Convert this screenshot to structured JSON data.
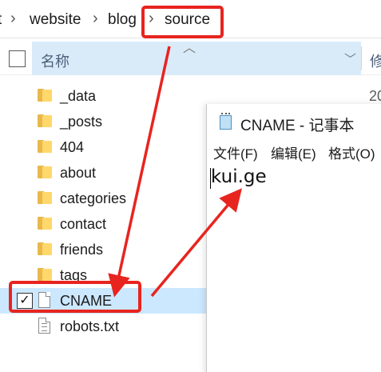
{
  "breadcrumb": {
    "items": [
      "t",
      "website",
      "blog",
      "source"
    ],
    "separator": "›"
  },
  "columns": {
    "name": "名称",
    "next_truncated": "修",
    "sort_icon": "chevron-up-icon",
    "dropdown_icon": "chevron-down-icon"
  },
  "files": [
    {
      "name": "_data",
      "type": "folder"
    },
    {
      "name": "_posts",
      "type": "folder"
    },
    {
      "name": "404",
      "type": "folder"
    },
    {
      "name": "about",
      "type": "folder"
    },
    {
      "name": "categories",
      "type": "folder"
    },
    {
      "name": "contact",
      "type": "folder"
    },
    {
      "name": "friends",
      "type": "folder"
    },
    {
      "name": "tags",
      "type": "folder"
    },
    {
      "name": "CNAME",
      "type": "file",
      "selected": true,
      "checked": "✓"
    },
    {
      "name": "robots.txt",
      "type": "text-file"
    }
  ],
  "date_column_partial": "20",
  "notepad": {
    "title": "CNAME - 记事本",
    "menu": [
      "文件(F)",
      "编辑(E)",
      "格式(O)"
    ],
    "content": "kui.ge"
  },
  "colors": {
    "annotation": "#e8241f",
    "selected_row": "#cce8ff",
    "header_highlight": "#d9ebf9",
    "folder": "#ffd76b"
  }
}
